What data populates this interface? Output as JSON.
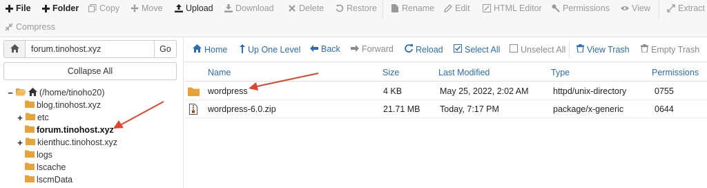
{
  "toolbar": {
    "items": [
      {
        "label": "File",
        "icon": "plus-icon"
      },
      {
        "label": "Folder",
        "icon": "plus-icon"
      },
      {
        "label": "Copy",
        "icon": "copy-icon"
      },
      {
        "label": "Move",
        "icon": "move-icon"
      },
      {
        "label": "Upload",
        "icon": "upload-icon"
      },
      {
        "label": "Download",
        "icon": "download-icon"
      },
      {
        "label": "Delete",
        "icon": "x-icon"
      },
      {
        "label": "Restore",
        "icon": "restore-icon"
      },
      {
        "label": "Rename",
        "icon": "rename-icon"
      },
      {
        "label": "Edit",
        "icon": "pencil-icon"
      },
      {
        "label": "HTML Editor",
        "icon": "html-editor-icon"
      },
      {
        "label": "Permissions",
        "icon": "key-icon"
      },
      {
        "label": "View",
        "icon": "eye-icon"
      },
      {
        "label": "Extract",
        "icon": "expand-icon"
      },
      {
        "label": "Compress",
        "icon": "compress-icon"
      }
    ]
  },
  "left": {
    "path_value": "forum.tinohost.xyz",
    "go_label": "Go",
    "collapse_label": "Collapse All",
    "tree": [
      {
        "label": "(/home/tinoho20)",
        "toggle": "−"
      },
      {
        "label": "blog.tinohost.xyz",
        "toggle": ""
      },
      {
        "label": "etc",
        "toggle": "+"
      },
      {
        "label": "forum.tinohost.xyz",
        "toggle": ""
      },
      {
        "label": "kienthuc.tinohost.xyz",
        "toggle": "+"
      },
      {
        "label": "logs",
        "toggle": ""
      },
      {
        "label": "lscache",
        "toggle": ""
      },
      {
        "label": "lscmData",
        "toggle": ""
      }
    ]
  },
  "right": {
    "toolbar": [
      {
        "label": "Home",
        "icon": "home-icon"
      },
      {
        "label": "Up One Level",
        "icon": "level-up-icon"
      },
      {
        "label": "Back",
        "icon": "arrow-left-icon"
      },
      {
        "label": "Forward",
        "icon": "arrow-right-icon"
      },
      {
        "label": "Reload",
        "icon": "reload-icon"
      },
      {
        "label": "Select All",
        "icon": "checkbox-checked-icon"
      },
      {
        "label": "Unselect All",
        "icon": "checkbox-empty-icon"
      },
      {
        "label": "View Trash",
        "icon": "trash-icon"
      },
      {
        "label": "Empty Trash",
        "icon": "trash-icon"
      }
    ],
    "columns": [
      "Name",
      "Size",
      "Last Modified",
      "Type",
      "Permissions"
    ],
    "rows": [
      {
        "name": "wordpress",
        "size": "4 KB",
        "modified": "May 25, 2022, 2:02 AM",
        "type": "httpd/unix-directory",
        "perms": "0755",
        "icon": "folder-icon"
      },
      {
        "name": "wordpress-6.0.zip",
        "size": "21.71 MB",
        "modified": "Today, 7:17 PM",
        "type": "package/x-generic",
        "perms": "0644",
        "icon": "zip-file-icon"
      }
    ]
  },
  "colors": {
    "link": "#2a6db0",
    "folder": "#e8a23a",
    "annotation_arrow": "#e0452b"
  }
}
